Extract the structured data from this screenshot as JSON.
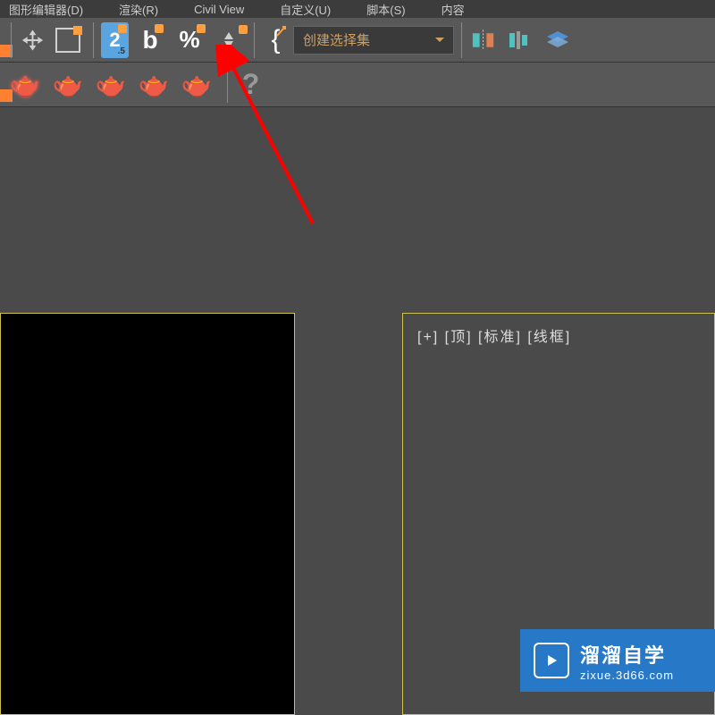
{
  "menu": {
    "item1": "图形编辑器(D)",
    "item2": "渲染(R)",
    "item3": "Civil View",
    "item4": "自定义(U)",
    "item5": "脚本(S)",
    "item6": "内容"
  },
  "toolbar": {
    "snap_value": "2",
    "snap_sub": ".5",
    "angle_label": "b",
    "percent_label": "%",
    "selection_set_label": "创建选择集"
  },
  "viewport": {
    "right_label": "[+] [顶] [标准] [线框]"
  },
  "watermark": {
    "title": "溜溜自学",
    "url": "zixue.3d66.com"
  }
}
